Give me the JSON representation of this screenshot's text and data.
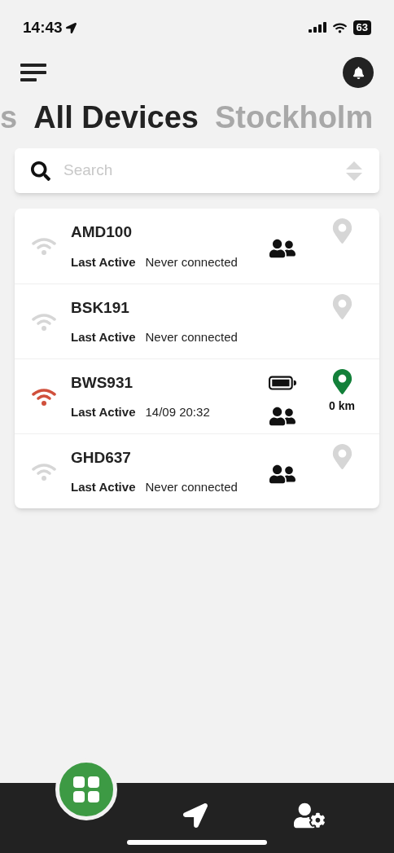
{
  "status_bar": {
    "time": "14:43",
    "battery": "63"
  },
  "tabs": [
    {
      "label": "s",
      "selected": false
    },
    {
      "label": "All Devices",
      "selected": true
    },
    {
      "label": "Stockholm",
      "selected": false
    }
  ],
  "search": {
    "placeholder": "Search"
  },
  "devices": [
    {
      "name": "AMD100",
      "last_active_label": "Last Active",
      "last_active": "Never connected",
      "connected": false,
      "battery": false,
      "group": true,
      "located": false
    },
    {
      "name": "BSK191",
      "last_active_label": "Last Active",
      "last_active": "Never connected",
      "connected": false,
      "battery": false,
      "group": false,
      "located": false
    },
    {
      "name": "BWS931",
      "last_active_label": "Last Active",
      "last_active": "14/09 20:32",
      "connected": true,
      "battery": true,
      "group": true,
      "located": true,
      "distance": "0 km"
    },
    {
      "name": "GHD637",
      "last_active_label": "Last Active",
      "last_active": "Never connected",
      "connected": false,
      "battery": false,
      "group": true,
      "located": false
    }
  ],
  "nav": [
    {
      "kind": "grid",
      "selected": true
    },
    {
      "kind": "navigate",
      "selected": false
    },
    {
      "kind": "user-settings",
      "selected": false
    }
  ]
}
